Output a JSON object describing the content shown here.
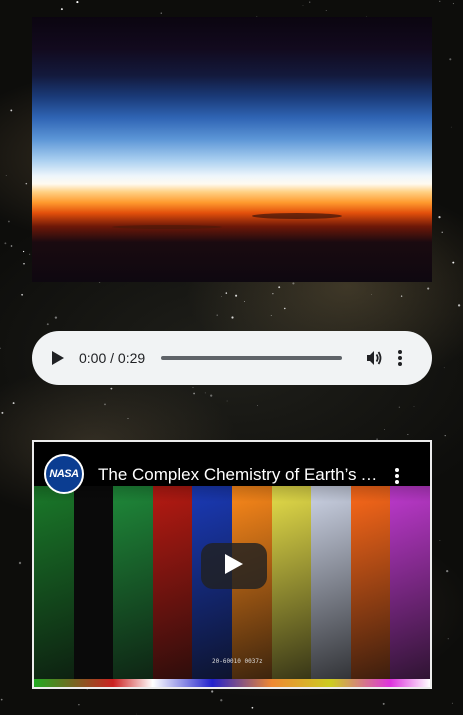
{
  "page": {
    "background": "starfield-nebula"
  },
  "photo": {
    "subject": "earth-horizon-from-orbit",
    "colors": {
      "deep_space": "#0b0510",
      "upper_atmosphere": "#2f64b4",
      "glow": "#eef6fb",
      "orange_band": "#ff9a2e",
      "red_band": "#e24f0b"
    }
  },
  "audio_player": {
    "time_display": "0:00 / 0:29",
    "progress": 0,
    "icons": {
      "play": "play-icon",
      "volume": "volume-icon",
      "more": "more-vert-icon"
    },
    "background_color": "#f1f3f4"
  },
  "video": {
    "channel_logo_text": "NASA",
    "title": "The Complex Chemistry of Earth’s Atmosphere",
    "caption": "20-60010 0037z",
    "icons": {
      "more": "more-vert-icon",
      "play": "play-icon"
    },
    "stripe_colors": [
      "#1a7a2a",
      "#0a0a0a",
      "#1f8a3a",
      "#b81a12",
      "#1a3ab8",
      "#ff8a1a",
      "#e8e04a",
      "#cfd6e8",
      "#ff6a1a",
      "#c03ad0"
    ]
  }
}
